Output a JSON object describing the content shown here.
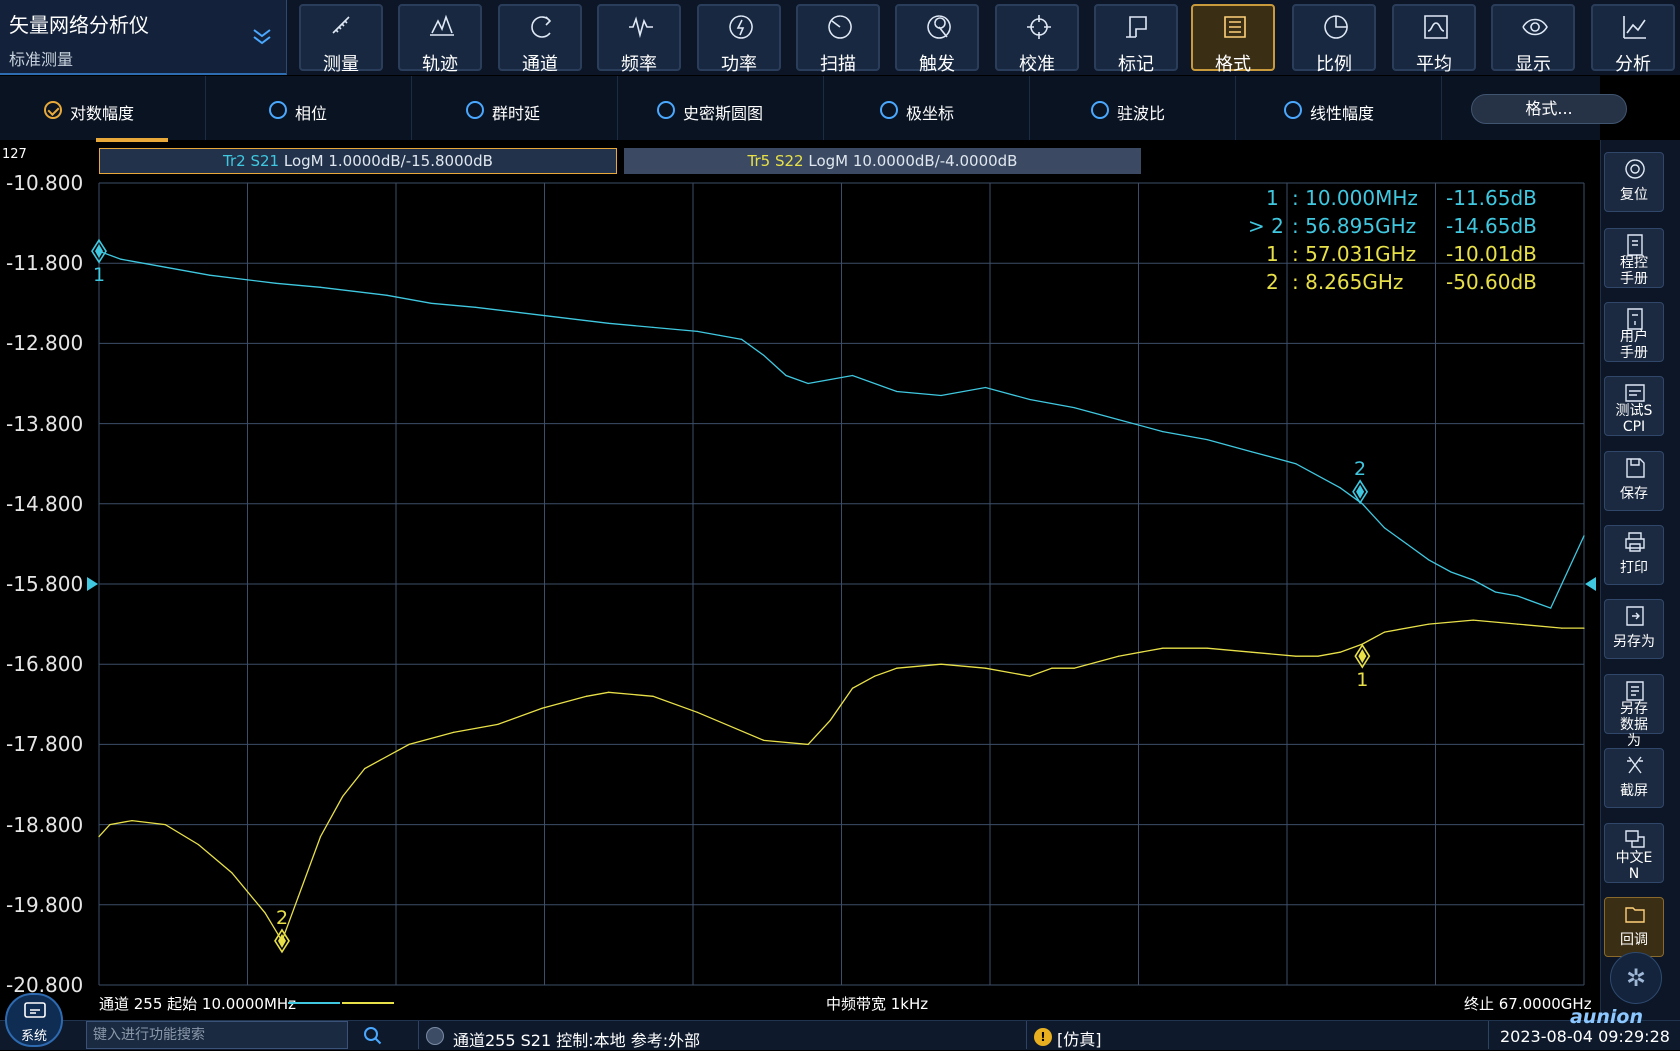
{
  "app": {
    "title": "矢量网络分析仪",
    "subtitle": "标准测量"
  },
  "toolbar": [
    {
      "label": "测量",
      "icon": "ruler-icon"
    },
    {
      "label": "轨迹",
      "icon": "trace-icon"
    },
    {
      "label": "通道",
      "icon": "channel-icon"
    },
    {
      "label": "频率",
      "icon": "frequency-icon"
    },
    {
      "label": "功率",
      "icon": "power-icon"
    },
    {
      "label": "扫描",
      "icon": "sweep-icon"
    },
    {
      "label": "触发",
      "icon": "trigger-icon"
    },
    {
      "label": "校准",
      "icon": "calibration-icon"
    },
    {
      "label": "标记",
      "icon": "marker-icon"
    },
    {
      "label": "格式",
      "icon": "format-icon",
      "active": true
    },
    {
      "label": "比例",
      "icon": "scale-icon"
    },
    {
      "label": "平均",
      "icon": "average-icon"
    },
    {
      "label": "显示",
      "icon": "display-icon"
    },
    {
      "label": "分析",
      "icon": "analysis-icon"
    }
  ],
  "formats": {
    "items": [
      "对数幅度",
      "相位",
      "群时延",
      "史密斯圆图",
      "极坐标",
      "驻波比",
      "线性幅度"
    ],
    "selected": "对数幅度",
    "button": "格式..."
  },
  "side": [
    {
      "label": "复位",
      "icon": "reset-icon"
    },
    {
      "label": "程控手册",
      "icon": "program-manual-icon"
    },
    {
      "label": "用户手册",
      "icon": "user-manual-icon"
    },
    {
      "label": "测试SCPI",
      "icon": "scpi-icon"
    },
    {
      "label": "保存",
      "icon": "save-icon"
    },
    {
      "label": "打印",
      "icon": "print-icon"
    },
    {
      "label": "另存为",
      "icon": "save-as-icon"
    },
    {
      "label": "另存数据为",
      "icon": "save-data-icon"
    },
    {
      "label": "截屏",
      "icon": "screenshot-icon"
    },
    {
      "label": "中文EN",
      "icon": "language-icon"
    },
    {
      "label": "回调",
      "icon": "recall-icon"
    }
  ],
  "plot": {
    "channel_number": "127",
    "trace1": {
      "id": "Tr2 S21",
      "desc": "LogM 1.0000dB/-15.8000dB",
      "color": "#3fc8e0"
    },
    "trace2": {
      "id": "Tr5 S22",
      "desc": "LogM 10.0000dB/-4.0000dB",
      "color": "#e8e048"
    },
    "y_ticks": [
      "-10.800",
      "-11.800",
      "-12.800",
      "-13.800",
      "-14.800",
      "-15.800",
      "-16.800",
      "-17.800",
      "-18.800",
      "-19.800",
      "-20.800"
    ],
    "footer_left": "通道 255 起始 10.0000MHz",
    "footer_mid": "中频带宽 1kHz",
    "footer_right": "终止 67.0000GHz",
    "markers": [
      {
        "num": "1",
        "freq": ": 10.000MHz",
        "val": "-11.65dB",
        "active": false,
        "color": "#3fc8e0"
      },
      {
        "num": "> 2",
        "freq": ": 56.895GHz",
        "val": "-14.65dB",
        "active": true,
        "color": "#3fc8e0"
      },
      {
        "num": "1",
        "freq": ": 57.031GHz",
        "val": "-10.01dB",
        "active": false,
        "color": "#e8e048"
      },
      {
        "num": "2",
        "freq": ": 8.265GHz",
        "val": "-50.60dB",
        "active": false,
        "color": "#e8e048"
      }
    ]
  },
  "status": {
    "system": "系统",
    "search_placeholder": "键入进行功能搜索",
    "text": "通道255 S21 控制:本地 参考:外部",
    "sim": "[仿真]",
    "datetime": "2023-08-04 09:29:28",
    "logo": "aunion"
  },
  "chart_data": {
    "type": "line",
    "x_unit": "GHz",
    "xlim": [
      0.01,
      67.0
    ],
    "ylim": [
      -20.8,
      -10.8
    ],
    "series": [
      {
        "name": "Tr2 S21",
        "color": "#3fc8e0",
        "x": [
          0.01,
          1,
          3,
          5,
          8,
          10,
          13,
          15,
          17,
          20,
          23,
          25,
          27,
          28,
          29,
          30,
          31,
          32,
          34,
          36,
          38,
          40,
          42,
          44,
          46,
          48,
          50,
          52,
          54,
          56,
          57,
          58,
          59,
          60,
          61,
          62,
          63,
          64,
          65,
          65.5,
          66,
          67
        ],
        "y": [
          -11.65,
          -11.75,
          -11.85,
          -11.95,
          -12.05,
          -12.1,
          -12.2,
          -12.3,
          -12.35,
          -12.45,
          -12.55,
          -12.6,
          -12.65,
          -12.7,
          -12.75,
          -12.95,
          -13.2,
          -13.3,
          -13.2,
          -13.4,
          -13.45,
          -13.35,
          -13.5,
          -13.6,
          -13.75,
          -13.9,
          -14.0,
          -14.15,
          -14.3,
          -14.6,
          -14.8,
          -15.1,
          -15.3,
          -15.5,
          -15.65,
          -15.75,
          -15.9,
          -15.95,
          -16.05,
          -16.1,
          -15.8,
          -15.2
        ]
      },
      {
        "name": "Tr5 S22",
        "color": "#e8e048",
        "x": [
          0.01,
          0.5,
          1.5,
          3,
          4.5,
          6,
          7.5,
          8.265,
          9,
          10,
          11,
          12,
          14,
          16,
          18,
          20,
          22,
          23,
          25,
          27,
          30,
          32,
          33,
          34,
          35,
          36,
          38,
          40,
          42,
          43,
          44,
          46,
          48,
          50,
          52,
          54,
          55,
          56,
          57,
          58,
          60,
          62,
          64,
          66,
          67
        ],
        "y": [
          -18.95,
          -18.8,
          -18.75,
          -18.8,
          -19.05,
          -19.4,
          -19.9,
          -20.25,
          -19.7,
          -18.95,
          -18.45,
          -18.1,
          -17.8,
          -17.65,
          -17.55,
          -17.35,
          -17.2,
          -17.15,
          -17.2,
          -17.4,
          -17.75,
          -17.8,
          -17.5,
          -17.1,
          -16.95,
          -16.85,
          -16.8,
          -16.85,
          -16.95,
          -16.85,
          -16.85,
          -16.7,
          -16.6,
          -16.6,
          -16.65,
          -16.7,
          -16.7,
          -16.65,
          -16.55,
          -16.4,
          -16.3,
          -16.25,
          -16.3,
          -16.35,
          -16.35
        ]
      }
    ]
  }
}
